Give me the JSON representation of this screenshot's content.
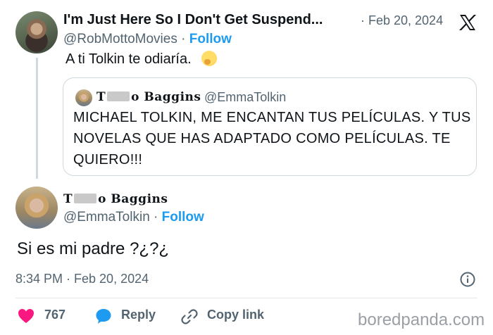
{
  "tweet": {
    "author_name": "I'm Just Here So I Don't Get Suspend...",
    "date": "· Feb 20, 2024",
    "handle": "@RobMottoMovies",
    "follow_sep": " · ",
    "follow_label": "Follow",
    "text": "A ti Tolkin te odiaría."
  },
  "quoted": {
    "name_prefix": "T",
    "name_suffix": "o Baggins",
    "handle": "@EmmaTolkin",
    "text": "MICHAEL TOLKIN, ME ENCANTAN TUS PELÍCULAS. Y TUS NOVELAS QUE HAS ADAPTADO COMO PELÍCULAS. TE QUIERO!!!"
  },
  "reply": {
    "name_prefix": "T",
    "name_suffix": "o Baggins",
    "handle": "@EmmaTolkin",
    "follow_sep": " · ",
    "follow_label": "Follow",
    "text": "Si es mi padre ?¿?¿",
    "time": "8:34 PM · Feb 20, 2024"
  },
  "actions": {
    "likes": "767",
    "reply_label": "Reply",
    "copy_label": "Copy link"
  },
  "watermark": "boredpanda.com",
  "colors": {
    "accent": "#1d9bf0",
    "like": "#f91880",
    "text": "#0f1419",
    "muted": "#536471"
  }
}
